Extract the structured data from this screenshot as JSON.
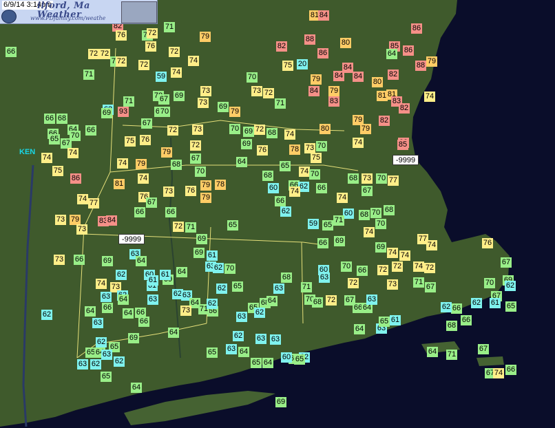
{
  "header": {
    "timestamp": "6/9/14 3:14pm",
    "title": "ilford, Ma",
    "subtitle": "Weather",
    "url": "www.PDfamily.com/weathe"
  },
  "map_labels": {
    "ken": "KEN"
  },
  "colors": {
    "water": "#0a0d2a",
    "land": "#3f5a2c",
    "boundary": "#e6e07a",
    "cold": "#7ff2ee",
    "cool": "#99ee88",
    "mild": "#ffee88",
    "warm": "#ffcc66",
    "hot": "#f59088"
  },
  "stations": [
    "82",
    "81",
    "84",
    "86",
    "76",
    "71",
    "72",
    "71",
    "79",
    "88",
    "82",
    "80",
    "85",
    "86",
    "79",
    "72",
    "72",
    "76",
    "72",
    "72",
    "74",
    "75",
    "20",
    "84",
    "86",
    "64",
    "84",
    "88",
    "79",
    "71",
    "70",
    "72",
    "59",
    "74",
    "79",
    "70",
    "83",
    "84",
    "80",
    "82",
    "81",
    "74",
    "66",
    "71",
    "70",
    "73",
    "67",
    "69",
    "73",
    "84",
    "81",
    "83",
    "82",
    "66",
    "68",
    "62",
    "69",
    "93",
    "65",
    "70",
    "73",
    "69",
    "79",
    "72",
    "71",
    "80",
    "79",
    "79",
    "82",
    "66",
    "64",
    "66",
    "67",
    "72",
    "73",
    "70",
    "69",
    "68",
    "74",
    "78",
    "88",
    "85",
    "65",
    "67",
    "70",
    "69",
    "72",
    "73",
    "70",
    "75",
    "74",
    "75",
    "76",
    "79",
    "67",
    "72",
    "74",
    "74",
    "79",
    "68",
    "64",
    "65",
    "70",
    "77",
    "9999",
    "76",
    "74",
    "86",
    "81",
    "74",
    "70",
    "68",
    "60",
    "66",
    "74",
    "70",
    "68",
    "73",
    "67",
    "75",
    "74",
    "77",
    "73",
    "79",
    "66",
    "62",
    "66",
    "74",
    "76",
    "67",
    "76",
    "79",
    "78",
    "74",
    "60",
    "68",
    "70",
    "68",
    "73",
    "79",
    "73",
    "83",
    "84",
    "66",
    "66",
    "65",
    "62",
    "59",
    "69",
    "70",
    "77",
    "74",
    "76",
    "9999",
    "72",
    "71",
    "69",
    "61",
    "70",
    "69",
    "66",
    "65",
    "71",
    "69",
    "74",
    "74",
    "72",
    "74",
    "73",
    "66",
    "69",
    "62",
    "63",
    "64",
    "60",
    "61",
    "69",
    "63",
    "60",
    "70",
    "72",
    "74",
    "72",
    "74",
    "73",
    "62",
    "61",
    "61",
    "64",
    "62",
    "62",
    "65",
    "66",
    "72",
    "73",
    "71",
    "67",
    "70",
    "67",
    "69",
    "67",
    "62",
    "63",
    "64",
    "66",
    "65",
    "68",
    "70",
    "68",
    "72",
    "67",
    "66",
    "64",
    "63",
    "66",
    "62",
    "63",
    "64",
    "66",
    "63",
    "73",
    "71",
    "62",
    "63",
    "62",
    "64",
    "63",
    "68",
    "71",
    "63",
    "64",
    "63",
    "66",
    "64",
    "66",
    "62",
    "62",
    "65",
    "69",
    "64",
    "62",
    "63",
    "63",
    "65",
    "64",
    "63",
    "62",
    "65",
    "63",
    "64",
    "65",
    "64",
    "66",
    "62",
    "63",
    "62",
    "65",
    "64",
    "60",
    "65",
    "64",
    "63",
    "65",
    "61",
    "68",
    "66",
    "62",
    "61",
    "65",
    "62",
    "64",
    "71",
    "67",
    "67",
    "74",
    "66",
    "69"
  ]
}
